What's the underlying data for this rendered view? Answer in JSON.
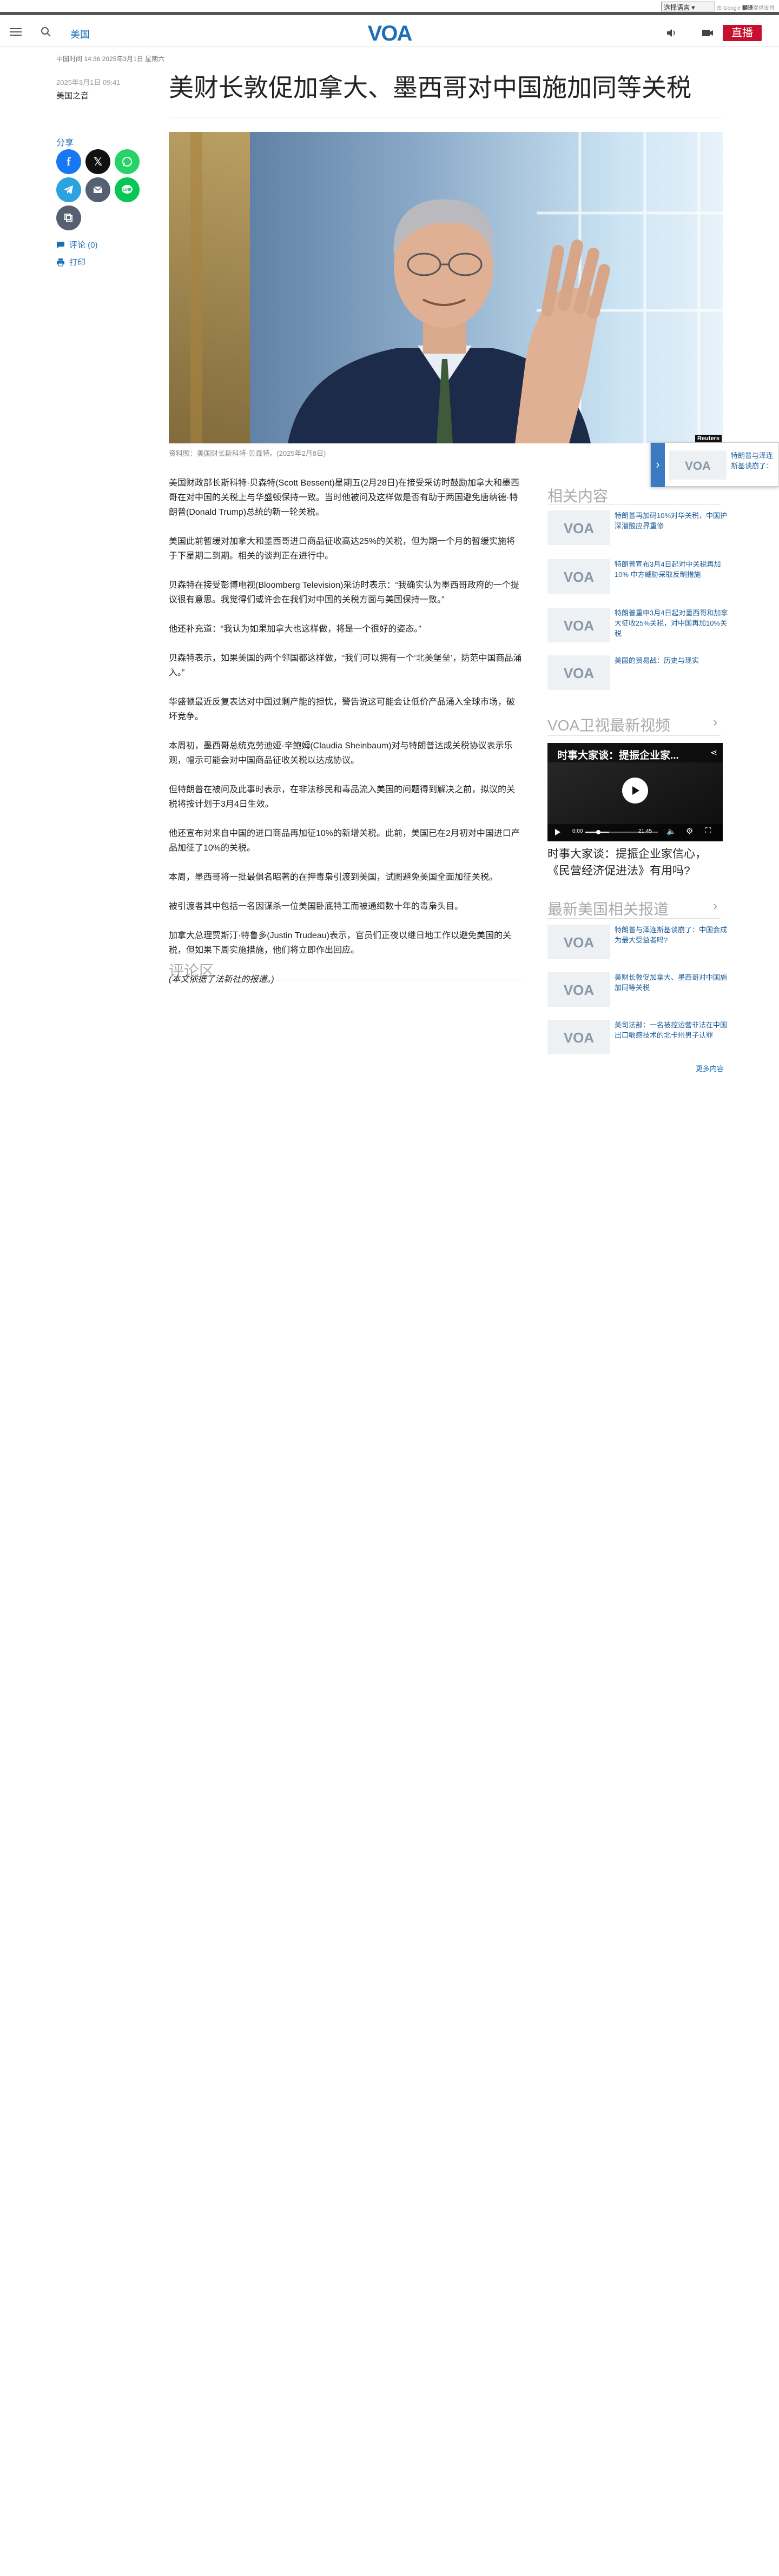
{
  "topbar": {
    "language_select": "选择语言",
    "translate_by": "由 Google",
    "translate_brand": "翻译",
    "translate_suffix": "提供支持"
  },
  "header": {
    "section": "美国",
    "logo": "VOA",
    "live_label": "直播"
  },
  "article": {
    "breadcrumb_date": "中国时间 14:36 2025年3月1日 星期六",
    "pub_date": "2025年3月1日 09:41",
    "author": "美国之音",
    "title": "美财长敦促加拿大、墨西哥对中国施加同等关税",
    "share_label": "分享",
    "comments_label": "评论 (0)",
    "print_label": "打印",
    "image_credit": "Reuters",
    "caption": "资料照：美国财长斯科特·贝森特。(2025年2月8日)",
    "paragraphs": [
      "美国财政部长斯科特·贝森特(Scott Bessent)星期五(2月28日)在接受采访时鼓励加拿大和墨西哥在对中国的关税上与华盛顿保持一致。当时他被问及这样做是否有助于两国避免唐纳德·特朗普(Donald Trump)总统的新一轮关税。",
      "美国此前暂缓对加拿大和墨西哥进口商品征收高达25%的关税，但为期一个月的暂缓实施将于下星期二到期。相关的谈判正在进行中。",
      "贝森特在接受彭博电视(Bloomberg Television)采访时表示：“我确实认为墨西哥政府的一个提议很有意思。我觉得们或许会在我们对中国的关税方面与美国保持一致。”",
      "他还补充道：“我认为如果加拿大也这样做，将是一个很好的姿态。”",
      "贝森特表示，如果美国的两个邻国都这样做，“我们可以拥有一个‘北美堡垒’，防范中国商品涌入。”",
      "华盛顿最近反复表达对中国过剩产能的担忧，警告说这可能会让低价产品涌入全球市场，破坏竞争。",
      "本周初，墨西哥总统克劳迪娅·辛鲍姆(Claudia Sheinbaum)对与特朗普达成关税协议表示乐观，幅示可能会对中国商品征收关税以达成协议。",
      "但特朗普在被问及此事时表示，在非法移民和毒品流入美国的问题得到解决之前，拟议的关税将按计划于3月4日生效。",
      "他还宣布对来自中国的进口商品再加征10%的新增关税。此前，美国已在2月初对中国进口产品加征了10%的关税。",
      "本周，墨西哥将一批最俱名昭著的在押毒枭引渡到美国，试图避免美国全面加征关税。",
      "被引渡者其中包括一名因谋杀一位美国卧底特工而被通缉数十年的毒枭头目。",
      "加拿大总理贾斯汀·特鲁多(Justin Trudeau)表示，官员们正夜以继日地工作以避免美国的关税，但如果下周实施措施，他们将立即作出回应。",
      "(本文依据了法新社的报道。)"
    ],
    "comments_title": "评论区"
  },
  "sidebar": {
    "related_title": "相关内容",
    "related": [
      "特朗普再加码10%对华关税，中国护深潜酸应界重修",
      "特朗普宣布3月4日起对中关税再加10% 中方威胁采取反制措施",
      "特朗普重申3月4日起对墨西哥和加拿大征收25%关税，对中国再加10%关税",
      "美国的贸易战：历史与现实"
    ],
    "video_title": "VOA卫视最新视频",
    "video_overlay_title": "时事大家谈：提振企业家...",
    "video_time_current": "0:00",
    "video_time_total": "21:45",
    "video_caption": "时事大家谈：提振企业家信心，《民营经济促进法》有用吗?",
    "latest_title": "最新美国相关报道",
    "latest": [
      "特朗普与泽连斯基谈崩了：中国会成为最大受益者吗?",
      "美财长敦促加拿大、墨西哥对中国施加同等关税",
      "美司法部：一名被控运营非法在中国出口敏感技术的北卡州男子认罪"
    ],
    "more_label": "更多内容"
  },
  "floating": {
    "text": "特朗普与泽连斯基谈崩了：中国会成为最大受益者吗?"
  },
  "colors": {
    "brand_blue": "#1e6fb5",
    "live_red": "#c8102e",
    "facebook": "#1877f2",
    "x": "#111111",
    "whatsapp": "#25d366",
    "telegram": "#2aa3df",
    "email": "#556070",
    "line": "#06c755",
    "copy": "#556070"
  }
}
